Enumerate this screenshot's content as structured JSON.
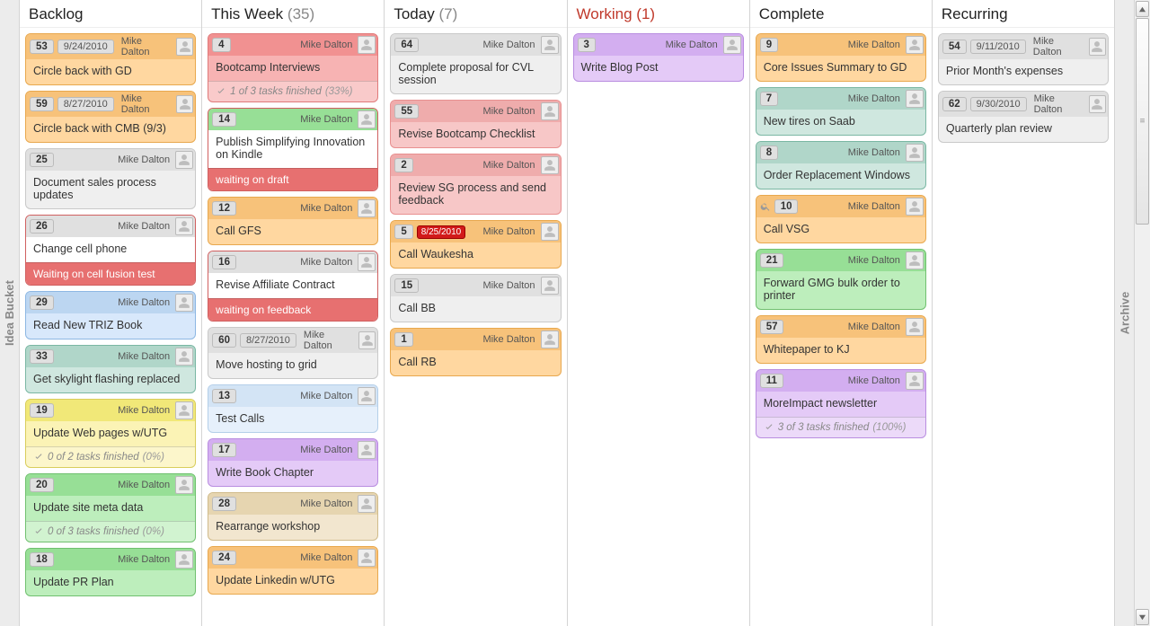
{
  "dock": {
    "left": "Idea Bucket",
    "right": "Archive"
  },
  "columns": [
    {
      "title": "Backlog",
      "count": null,
      "working": false,
      "cards": [
        {
          "n": "53",
          "date": "9/24/2010",
          "who": "Mike Dalton",
          "color": "c-orange",
          "title": "Circle back with GD"
        },
        {
          "n": "59",
          "date": "8/27/2010",
          "who": "Mike Dalton",
          "color": "c-orange",
          "title": "Circle back with CMB (9/3)"
        },
        {
          "n": "25",
          "who": "Mike Dalton",
          "color": "c-gray",
          "title": "Document sales process updates"
        },
        {
          "n": "26",
          "who": "Mike Dalton",
          "color": "c-grayhdr",
          "title": "Change cell phone",
          "wait": "Waiting on cell fusion test"
        },
        {
          "n": "29",
          "who": "Mike Dalton",
          "color": "c-blue",
          "title": "Read New TRIZ Book"
        },
        {
          "n": "33",
          "who": "Mike Dalton",
          "color": "c-teal",
          "title": "Get skylight flashing replaced"
        },
        {
          "n": "19",
          "who": "Mike Dalton",
          "color": "c-yellow",
          "title": "Update Web pages w/UTG",
          "sub": "0 of 2 tasks finished",
          "pct": "(0%)"
        },
        {
          "n": "20",
          "who": "Mike Dalton",
          "color": "c-green",
          "title": "Update site meta data",
          "sub": "0 of 3 tasks finished",
          "pct": "(0%)"
        },
        {
          "n": "18",
          "who": "Mike Dalton",
          "color": "c-green",
          "title": "Update PR Plan"
        }
      ]
    },
    {
      "title": "This Week",
      "count": "(35)",
      "working": false,
      "cards": [
        {
          "n": "4",
          "who": "Mike Dalton",
          "color": "c-pink",
          "title": "Bootcamp Interviews",
          "sub": "1 of 3 tasks finished",
          "pct": "(33%)"
        },
        {
          "n": "14",
          "who": "Mike Dalton",
          "color": "c-greenhdr",
          "title": "Publish Simplifying Innovation on Kindle",
          "wait": "waiting on draft"
        },
        {
          "n": "12",
          "who": "Mike Dalton",
          "color": "c-orange",
          "title": "Call GFS"
        },
        {
          "n": "16",
          "who": "Mike Dalton",
          "color": "c-grayhdr",
          "title": "Revise Affiliate Contract",
          "wait": "waiting on feedback"
        },
        {
          "n": "60",
          "date": "8/27/2010",
          "who": "Mike Dalton",
          "color": "c-gray",
          "title": "Move hosting to grid"
        },
        {
          "n": "13",
          "who": "Mike Dalton",
          "color": "c-bluelite",
          "title": "Test Calls"
        },
        {
          "n": "17",
          "who": "Mike Dalton",
          "color": "c-purple",
          "title": "Write Book Chapter"
        },
        {
          "n": "28",
          "who": "Mike Dalton",
          "color": "c-tan",
          "title": "Rearrange workshop"
        },
        {
          "n": "24",
          "who": "Mike Dalton",
          "color": "c-orange",
          "title": "Update Linkedin w/UTG"
        }
      ]
    },
    {
      "title": "Today",
      "count": "(7)",
      "working": false,
      "cards": [
        {
          "n": "64",
          "who": "Mike Dalton",
          "color": "c-gray",
          "title": "Complete proposal for CVL session"
        },
        {
          "n": "55",
          "who": "Mike Dalton",
          "color": "c-pink2",
          "title": "Revise Bootcamp Checklist"
        },
        {
          "n": "2",
          "who": "Mike Dalton",
          "color": "c-pink2",
          "title": "Review SG process and send feedback"
        },
        {
          "n": "5",
          "date": "8/25/2010",
          "overdue": true,
          "who": "Mike Dalton",
          "color": "c-orange",
          "title": "Call Waukesha"
        },
        {
          "n": "15",
          "who": "Mike Dalton",
          "color": "c-gray",
          "title": "Call BB"
        },
        {
          "n": "1",
          "who": "Mike Dalton",
          "color": "c-orange",
          "title": "Call RB"
        }
      ]
    },
    {
      "title": "Working",
      "count": "(1)",
      "working": true,
      "cards": [
        {
          "n": "3",
          "who": "Mike Dalton",
          "color": "c-purple",
          "title": "Write Blog Post"
        }
      ]
    },
    {
      "title": "Complete",
      "count": null,
      "working": false,
      "cards": [
        {
          "n": "9",
          "who": "Mike Dalton",
          "color": "c-orange",
          "title": "Core Issues Summary to GD"
        },
        {
          "n": "7",
          "who": "Mike Dalton",
          "color": "c-teal",
          "title": "New tires on Saab"
        },
        {
          "n": "8",
          "who": "Mike Dalton",
          "color": "c-teal",
          "title": "Order Replacement Windows"
        },
        {
          "n": "10",
          "who": "Mike Dalton",
          "color": "c-orange",
          "title": "Call VSG",
          "icon": true
        },
        {
          "n": "21",
          "who": "Mike Dalton",
          "color": "c-green",
          "title": "Forward GMG bulk order to printer"
        },
        {
          "n": "57",
          "who": "Mike Dalton",
          "color": "c-orange",
          "title": "Whitepaper to KJ"
        },
        {
          "n": "11",
          "who": "Mike Dalton",
          "color": "c-purple",
          "title": "MoreImpact newsletter",
          "sub": "3 of 3 tasks finished",
          "pct": "(100%)"
        }
      ]
    },
    {
      "title": "Recurring",
      "count": null,
      "working": false,
      "cards": [
        {
          "n": "54",
          "date": "9/11/2010",
          "who": "Mike Dalton",
          "color": "c-gray",
          "title": "Prior Month's expenses"
        },
        {
          "n": "62",
          "date": "9/30/2010",
          "who": "Mike Dalton",
          "color": "c-gray",
          "title": "Quarterly plan review"
        }
      ]
    }
  ]
}
